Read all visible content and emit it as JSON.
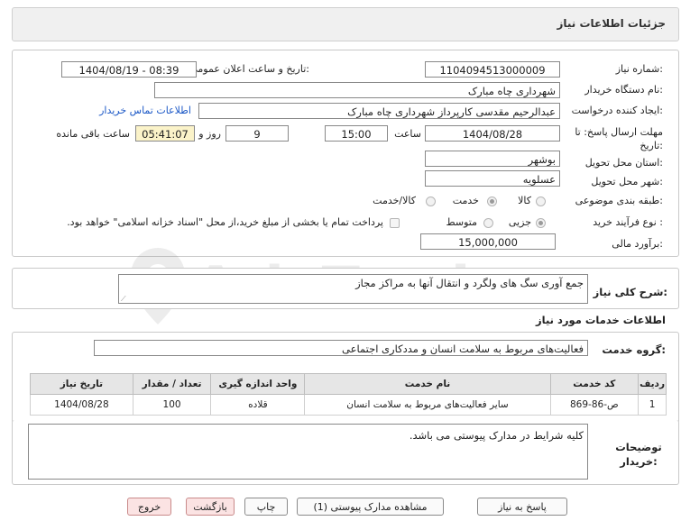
{
  "header": {
    "title": "جزئیات اطلاعات نیاز"
  },
  "watermark": {
    "text": "AriaTender.neT"
  },
  "form": {
    "need_number": {
      "label": "شماره نیاز:",
      "value": "1104094513000009"
    },
    "announce_datetime": {
      "label": "تاریخ و ساعت اعلان عمومی:",
      "value": "1404/08/19 - 08:39"
    },
    "buyer_org": {
      "label": "نام دستگاه خریدار:",
      "value": "شهرداری چاه مبارک"
    },
    "requester": {
      "label": "ایجاد کننده درخواست:",
      "value": "عبدالرحیم مقدسی کارپرداز شهرداری چاه مبارک"
    },
    "contact_link": "اطلاعات تماس خریدار",
    "deadline": {
      "label": "مهلت ارسال پاسخ: تا تاریخ:",
      "date": "1404/08/28",
      "time_label": "ساعت",
      "time": "15:00",
      "days": "9",
      "days_label": "روز و",
      "remaining": "05:41:07",
      "remaining_label": "ساعت باقی مانده"
    },
    "province": {
      "label": "استان محل تحویل:",
      "value": "بوشهر"
    },
    "city": {
      "label": "شهر محل تحویل:",
      "value": "عسلویه"
    },
    "category": {
      "label": "طبقه بندی موضوعی:",
      "options": [
        "کالا",
        "خدمت",
        "کالا/خدمت"
      ],
      "selected": "خدمت"
    },
    "process": {
      "label": "نوع فرآیند خرید :",
      "options": [
        "جزیی",
        "متوسط"
      ],
      "selected": "جزیی",
      "note": "پرداخت تمام یا بخشی از مبلغ خرید،از محل \"اسناد خزانه اسلامی\" خواهد بود."
    },
    "budget": {
      "label": "برآورد مالی:",
      "value": "15,000,000"
    }
  },
  "summary": {
    "label": "شرح کلی نیاز:",
    "value": "جمع آوری سگ های ولگرد و انتقال آنها به مراکز مجاز"
  },
  "services": {
    "section_title": "اطلاعات خدمات مورد نیاز",
    "group_label": "گروه خدمت:",
    "group_value": "فعالیت‌های مربوط به سلامت انسان و مددکاری اجتماعی",
    "columns": [
      "ردیف",
      "کد خدمت",
      "نام خدمت",
      "واحد اندازه گیری",
      "تعداد / مقدار",
      "تاریخ نیاز"
    ],
    "rows": [
      [
        "1",
        "ص-86-869",
        "سایر فعالیت‌های مربوط به سلامت انسان",
        "قلاده",
        "100",
        "1404/08/28"
      ]
    ]
  },
  "buyer_notes": {
    "label": "توضیحات خریدار:",
    "value": "کلیه شرایط در مدارک پیوستی می باشد."
  },
  "buttons": {
    "reply": "پاسخ به نیاز",
    "attachments": "مشاهده مدارک پیوستی (1)",
    "print": "چاپ",
    "back": "بازگشت",
    "exit": "خروج"
  },
  "colors": {
    "link": "#1a57c6",
    "remaining_bg": "#fbf3c9",
    "button_pink": "#fbe3e3"
  }
}
